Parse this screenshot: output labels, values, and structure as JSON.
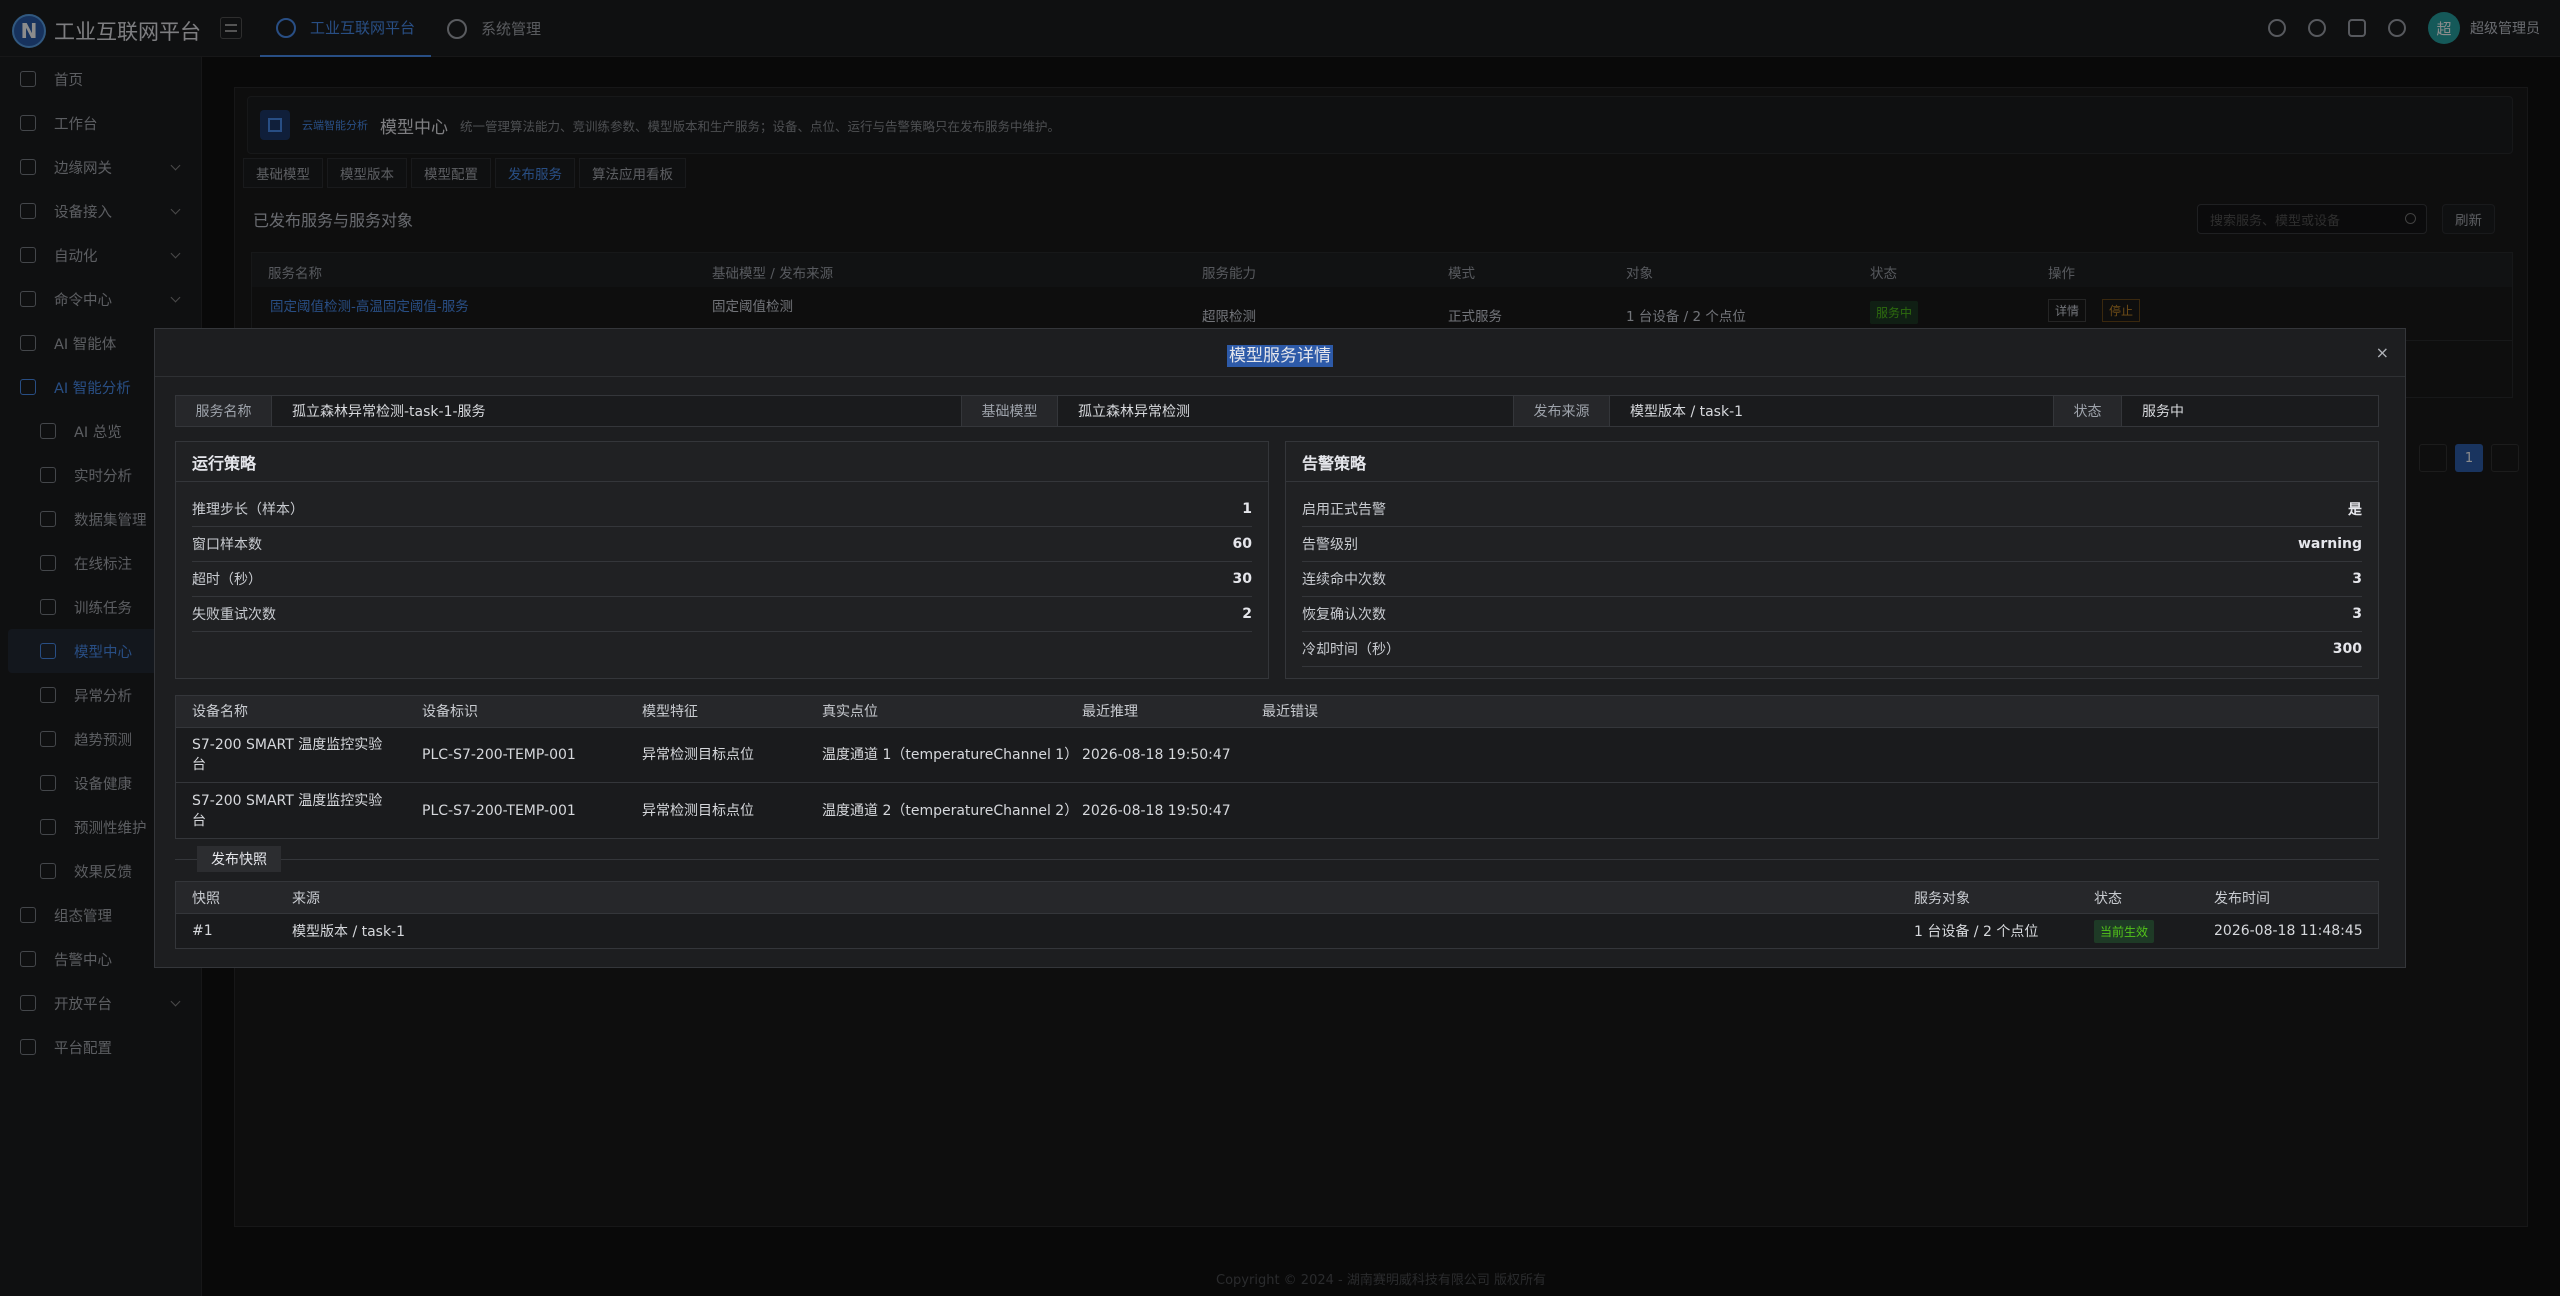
{
  "app": {
    "logo_letter": "N",
    "title": "工业互联网平台"
  },
  "topnav": [
    {
      "label": "工业互联网平台",
      "active": true
    },
    {
      "label": "系统管理",
      "active": false
    }
  ],
  "user": {
    "avatar_text": "超",
    "name": "超级管理员"
  },
  "sidebar": {
    "items": [
      {
        "label": "首页",
        "icon": "monitor-icon"
      },
      {
        "label": "工作台",
        "icon": "dashboard-icon"
      },
      {
        "label": "边缘网关",
        "icon": "gateway-icon",
        "expandable": true
      },
      {
        "label": "设备接入",
        "icon": "device-icon",
        "expandable": true
      },
      {
        "label": "自动化",
        "icon": "automation-icon",
        "expandable": true
      },
      {
        "label": "命令中心",
        "icon": "command-icon",
        "expandable": true
      },
      {
        "label": "AI 智能体",
        "icon": "robot-icon"
      },
      {
        "label": "AI 智能分析",
        "icon": "chart-icon",
        "expandable": true,
        "open": true
      },
      {
        "label": "AI 总览",
        "icon": "ai-icon",
        "sub": true
      },
      {
        "label": "实时分析",
        "icon": "realtime-icon",
        "sub": true
      },
      {
        "label": "数据集管理",
        "icon": "dataset-icon",
        "sub": true
      },
      {
        "label": "在线标注",
        "icon": "tag-icon",
        "sub": true
      },
      {
        "label": "训练任务",
        "icon": "clock-icon",
        "sub": true
      },
      {
        "label": "模型中心",
        "icon": "grid-icon",
        "sub": true,
        "active": true
      },
      {
        "label": "异常分析",
        "icon": "search-icon",
        "sub": true
      },
      {
        "label": "趋势预测",
        "icon": "trend-icon",
        "sub": true
      },
      {
        "label": "设备健康",
        "icon": "heart-icon",
        "sub": true
      },
      {
        "label": "预测性维护",
        "icon": "shield-icon",
        "sub": true
      },
      {
        "label": "效果反馈",
        "icon": "feedback-icon",
        "sub": true
      },
      {
        "label": "组态管理",
        "icon": "config-icon"
      },
      {
        "label": "告警中心",
        "icon": "alarm-icon"
      },
      {
        "label": "开放平台",
        "icon": "api-icon",
        "expandable": true
      },
      {
        "label": "平台配置",
        "icon": "settings-icon"
      }
    ]
  },
  "page": {
    "tag": "云端智能分析",
    "title": "模型中心",
    "desc": "统一管理算法能力、竞训练参数、模型版本和生产服务；设备、点位、运行与告警策略只在发布服务中维护。",
    "tabs": [
      {
        "label": "基础模型",
        "active": false
      },
      {
        "label": "模型版本",
        "active": false
      },
      {
        "label": "模型配置",
        "active": false
      },
      {
        "label": "发布服务",
        "active": true
      },
      {
        "label": "算法应用看板",
        "active": false
      }
    ],
    "section_title": "已发布服务与服务对象",
    "search_placeholder": "搜索服务、模型或设备",
    "refresh_label": "刷新",
    "table_headers": [
      "服务名称",
      "基础模型 / 发布来源",
      "服务能力",
      "模式",
      "对象",
      "状态",
      "操作"
    ],
    "bg_row": {
      "name": "固定阈值检测-高温固定阈值-服务",
      "model": "固定阈值检测",
      "capability": "超限检测",
      "mode": "正式服务",
      "target": "1 台设备 / 2 个点位",
      "status": "服务中",
      "action_detail": "详情",
      "action_stop": "停止"
    },
    "page_current": "1"
  },
  "footer": "Copyright © 2024 - 湖南赛明威科技有限公司 版权所有",
  "modal": {
    "title": "模型服务详情",
    "close": "×",
    "info": {
      "service_name_label": "服务名称",
      "service_name": "孤立森林异常检测-task-1-服务",
      "base_model_label": "基础模型",
      "base_model": "孤立森林异常检测",
      "source_label": "发布来源",
      "source": "模型版本 / task-1",
      "status_label": "状态",
      "status": "服务中"
    },
    "run_policy": {
      "title": "运行策略",
      "items": [
        {
          "k": "推理步长（样本）",
          "v": "1"
        },
        {
          "k": "窗口样本数",
          "v": "60"
        },
        {
          "k": "超时（秒）",
          "v": "30"
        },
        {
          "k": "失败重试次数",
          "v": "2"
        }
      ]
    },
    "alarm_policy": {
      "title": "告警策略",
      "items": [
        {
          "k": "启用正式告警",
          "v": "是"
        },
        {
          "k": "告警级别",
          "v": "warning"
        },
        {
          "k": "连续命中次数",
          "v": "3"
        },
        {
          "k": "恢复确认次数",
          "v": "3"
        },
        {
          "k": "冷却时间（秒）",
          "v": "300"
        }
      ]
    },
    "devices": {
      "headers": [
        "设备名称",
        "设备标识",
        "模型特征",
        "真实点位",
        "最近推理",
        "最近错误"
      ],
      "rows": [
        [
          "S7-200 SMART 温度监控实验台",
          "PLC-S7-200-TEMP-001",
          "异常检测目标点位",
          "温度通道 1（temperatureChannel 1）",
          "2026-08-18 19:50:47",
          ""
        ],
        [
          "S7-200 SMART 温度监控实验台",
          "PLC-S7-200-TEMP-001",
          "异常检测目标点位",
          "温度通道 2（temperatureChannel 2）",
          "2026-08-18 19:50:47",
          ""
        ]
      ]
    },
    "snapshot": {
      "label": "发布快照",
      "headers": [
        "快照",
        "来源",
        "服务对象",
        "状态",
        "发布时间"
      ],
      "rows": [
        {
          "id": "#1",
          "source": "模型版本 / task-1",
          "target": "1 台设备 / 2 个点位",
          "status": "当前生效",
          "time": "2026-08-18 11:48:45"
        }
      ]
    }
  }
}
